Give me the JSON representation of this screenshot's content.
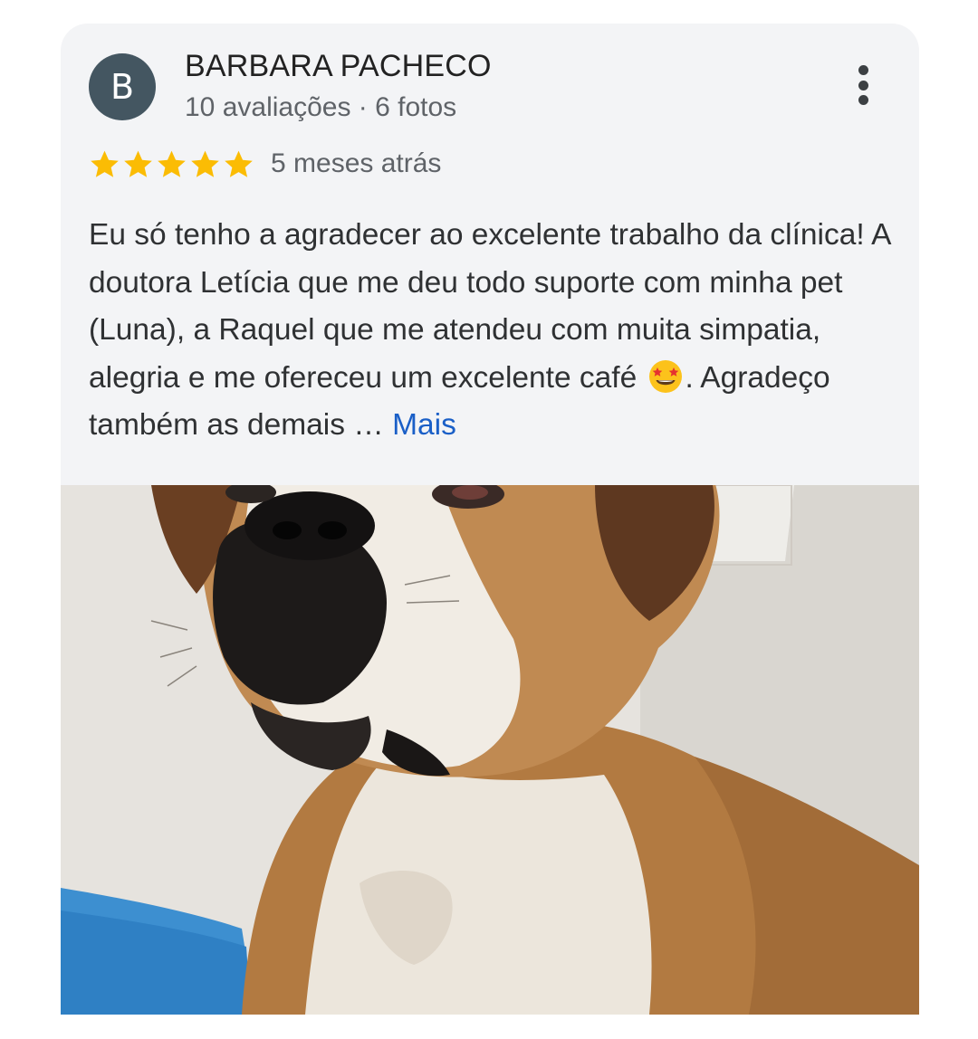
{
  "review": {
    "avatar_letter": "B",
    "reviewer_name": "BARBARA PACHECO",
    "reviewer_meta": "10 avaliações · 6 fotos",
    "rating": 5,
    "rating_max": 5,
    "time_ago": "5 meses atrás",
    "text_before_emoji": "Eu só tenho a agradecer ao excelente trabalho da clínica! A doutora Letícia que me deu todo suporte com minha pet (Luna), a Raquel que me atendeu com muita simpatia, alegria e me ofereceu um excelente café ",
    "emoji_icon": "star-struck-emoji-icon",
    "text_after_emoji": ". Agradeço também as demais … ",
    "more_label": "Mais"
  },
  "colors": {
    "card_background": "#f3f4f6",
    "avatar": "#445661",
    "star": "#fbbc04",
    "link": "#1a5fc7",
    "text": "#2f3133",
    "secondary_text": "#5f6368"
  },
  "icons": {
    "menu": "more-vert-icon",
    "star": "star-icon"
  }
}
